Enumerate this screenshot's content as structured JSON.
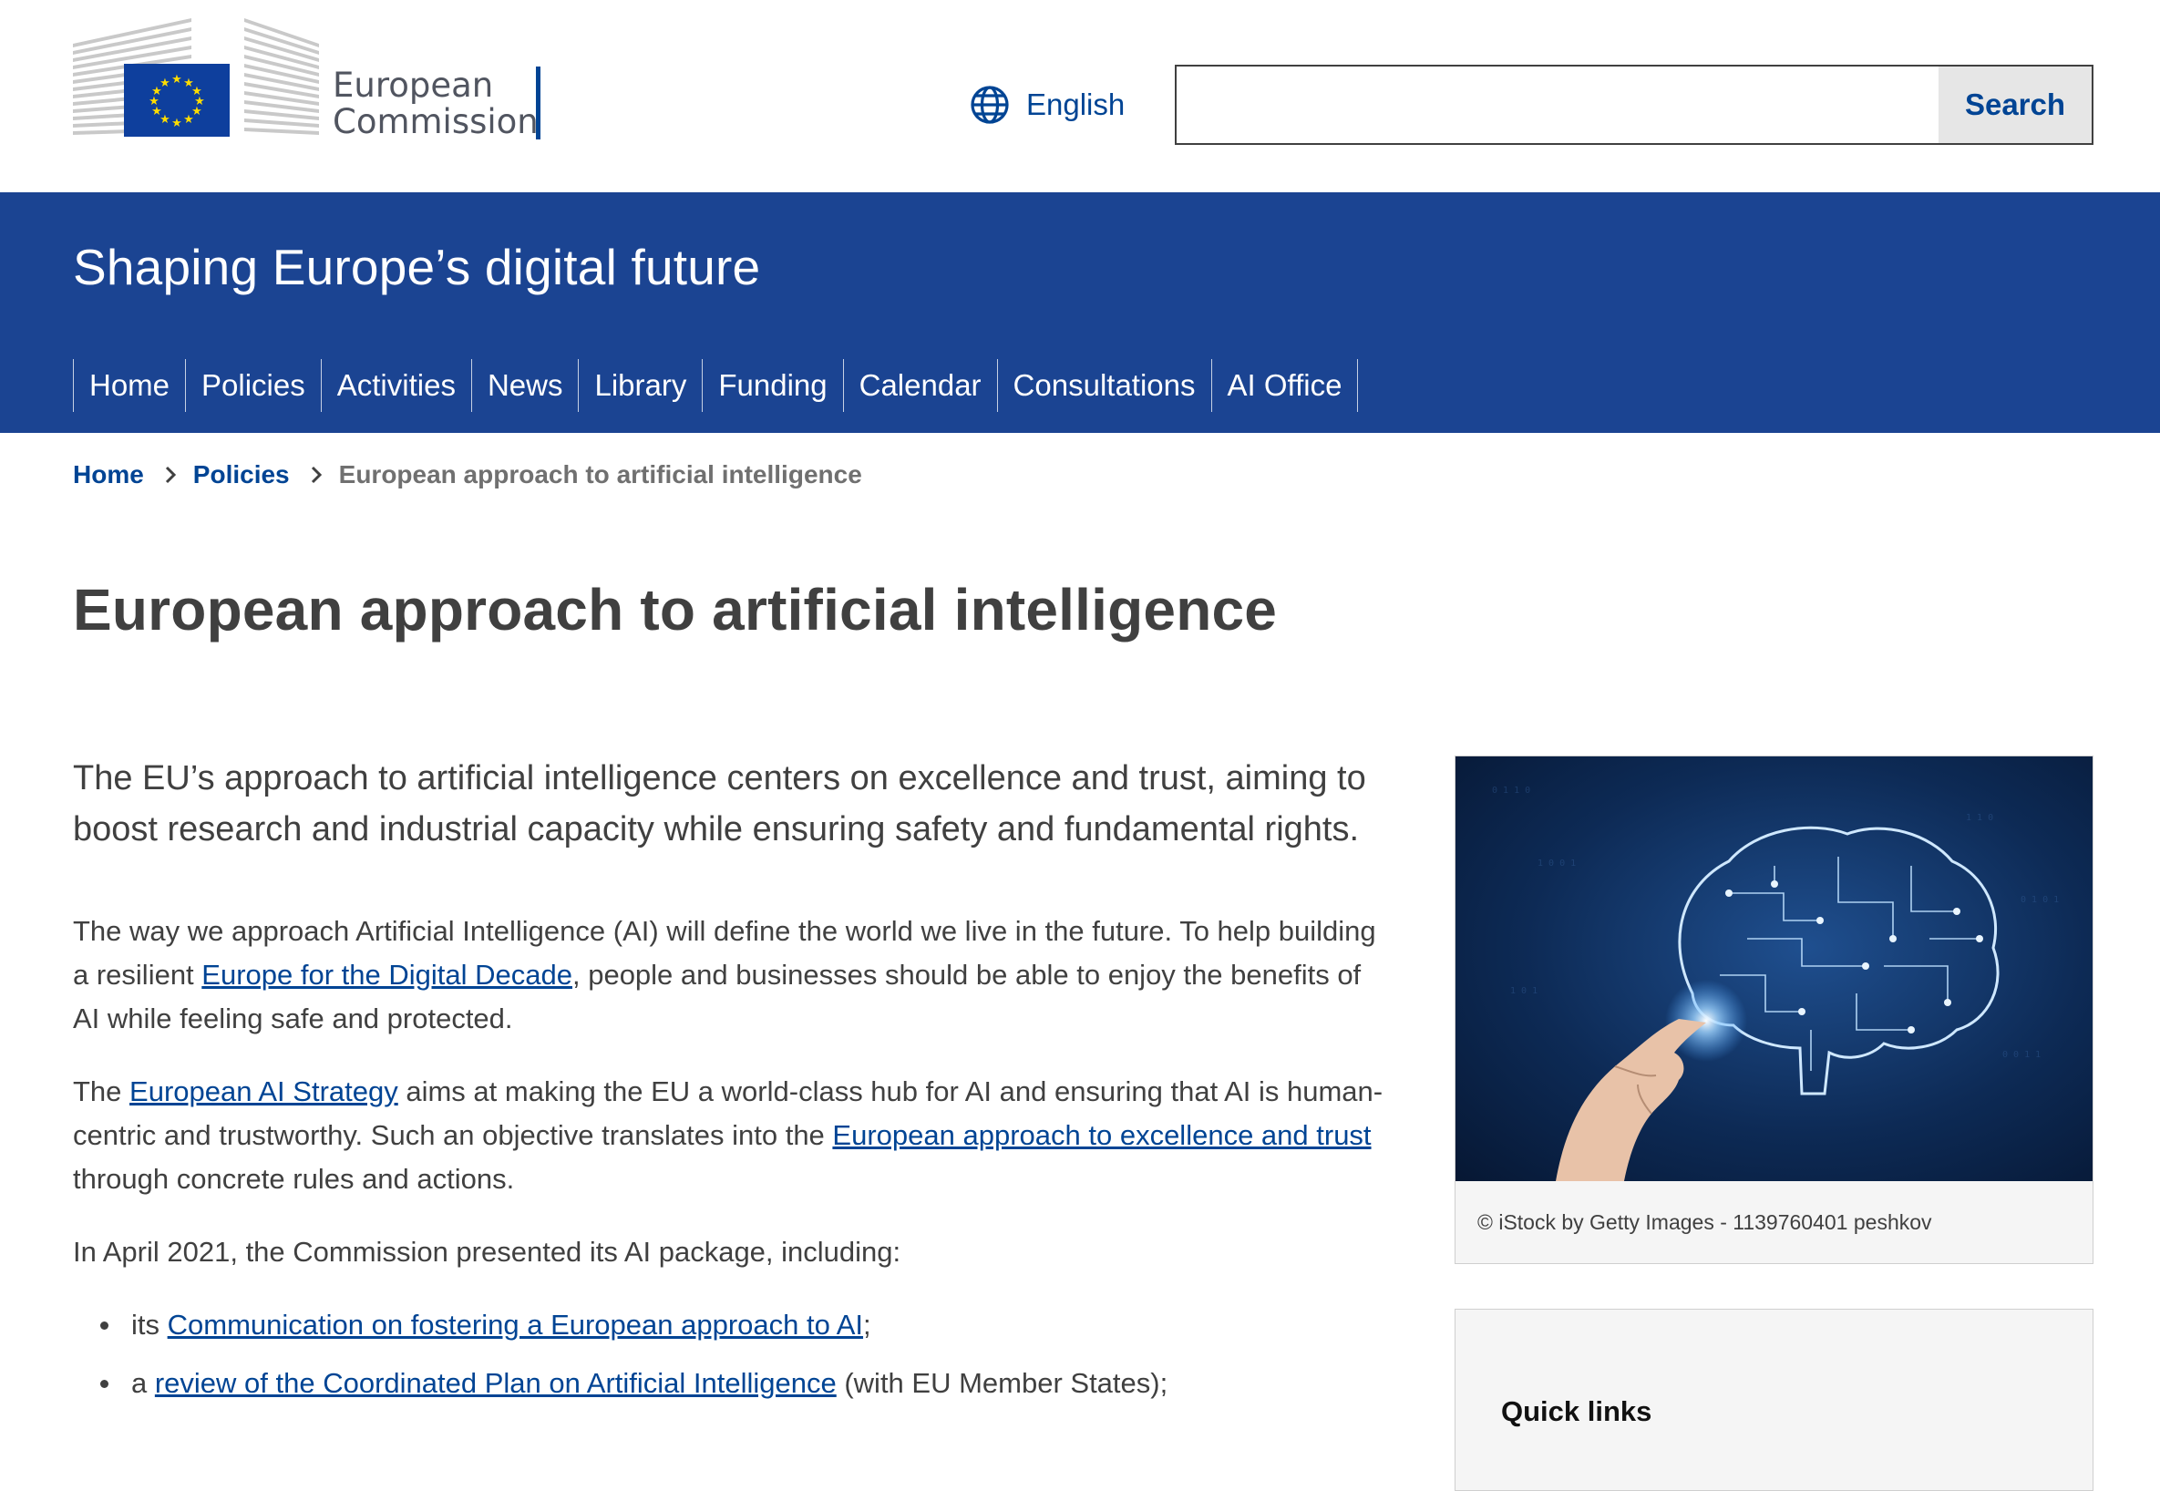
{
  "header": {
    "logo_line1": "European",
    "logo_line2": "Commission",
    "language": "English",
    "search_placeholder": "",
    "search_button": "Search"
  },
  "banner": {
    "site_name": "Shaping Europe’s digital future"
  },
  "nav": {
    "items": [
      "Home",
      "Policies",
      "Activities",
      "News",
      "Library",
      "Funding",
      "Calendar",
      "Consultations",
      "AI Office"
    ]
  },
  "breadcrumb": {
    "home": "Home",
    "policies": "Policies",
    "current": "European approach to artificial intelligence"
  },
  "page": {
    "title": "European approach to artificial intelligence",
    "lead": "The EU’s approach to artificial intelligence centers on excellence and trust, aiming to boost research and industrial capacity while ensuring safety and fundamental rights.",
    "p1_before": "The way we approach Artificial Intelligence (AI) will define the world we live in the future. To help building a resilient ",
    "p1_link": "Europe for the Digital Decade",
    "p1_after": ", people and businesses should be able to enjoy the benefits of AI while feeling safe and protected.",
    "p2_before": "The ",
    "p2_link1": "European AI Strategy",
    "p2_middle": " aims at making the EU a world-class hub for AI and ensuring that AI is human-centric and trustworthy. Such an objective translates into the ",
    "p2_link2": "European approach to excellence and trust",
    "p2_after": " through concrete rules and actions.",
    "p3": "In April 2021, the Commission presented its AI package, including:",
    "list": [
      {
        "before": "its ",
        "link": "Communication on fostering a European approach to AI",
        "after": ";"
      },
      {
        "before": "a ",
        "link": "review of the Coordinated Plan on Artificial Intelligence",
        "after": " (with EU Member States);"
      }
    ]
  },
  "sidebar": {
    "image_caption": "© iStock by Getty Images - 1139760401 peshkov",
    "quick_links_title": "Quick links"
  },
  "colors": {
    "brand_blue": "#1b4492",
    "link_blue": "#004494",
    "text": "#404040",
    "eu_yellow": "#ffdd00"
  }
}
